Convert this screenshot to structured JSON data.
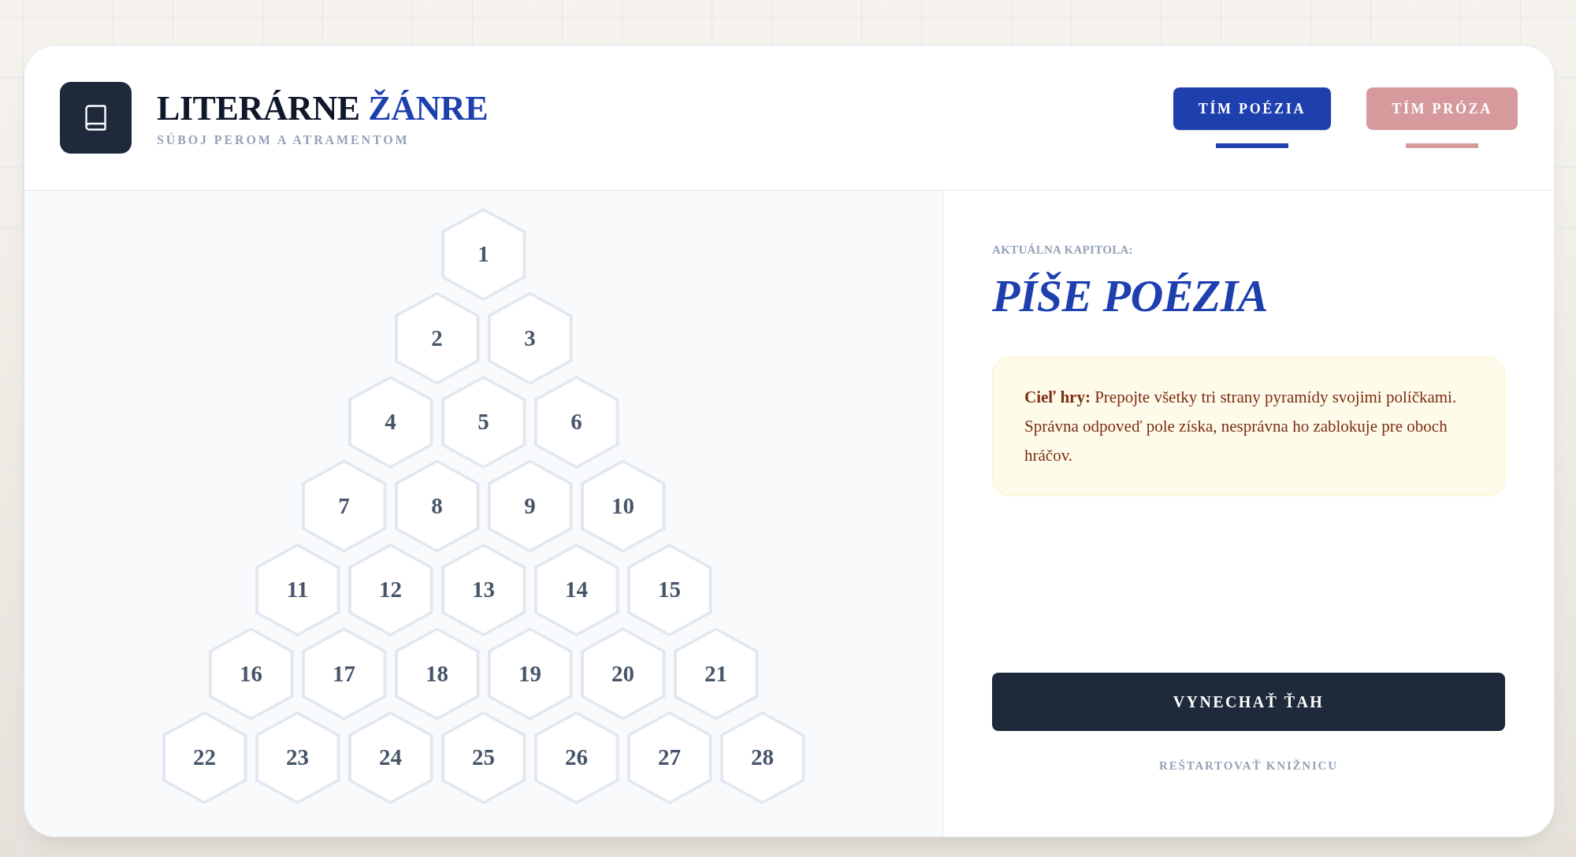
{
  "header": {
    "title": {
      "main": "LITERÁRNE",
      "accent": "ŽÁNRE"
    },
    "subtitle": "SÚBOJ PEROM A ATRAMENTOM",
    "teams": [
      {
        "label": "TÍM POÉZIA",
        "selected": true,
        "color": "#1e40af"
      },
      {
        "label": "TÍM PRÓZA",
        "selected": false,
        "color": "#d69a9d"
      }
    ]
  },
  "board": {
    "rows": [
      [
        "1"
      ],
      [
        "2",
        "3"
      ],
      [
        "4",
        "5",
        "6"
      ],
      [
        "7",
        "8",
        "9",
        "10"
      ],
      [
        "11",
        "12",
        "13",
        "14",
        "15"
      ],
      [
        "16",
        "17",
        "18",
        "19",
        "20",
        "21"
      ],
      [
        "22",
        "23",
        "24",
        "25",
        "26",
        "27",
        "28"
      ]
    ]
  },
  "sidebar": {
    "caption": "AKTUÁLNA KAPITOLA:",
    "chapter_title": "PÍŠE POÉZIA",
    "rules": "**Cieľ hry:** Prepojte všetky tri strany pyramídy svojimi políčkami. Správna odpoveď pole získa, nesprávna ho zablokuje pre oboch hráčov.",
    "skip_button": "VYNECHAŤ ŤAH",
    "restart_link": "REŠTARTOVAŤ KNIŽNICU"
  }
}
